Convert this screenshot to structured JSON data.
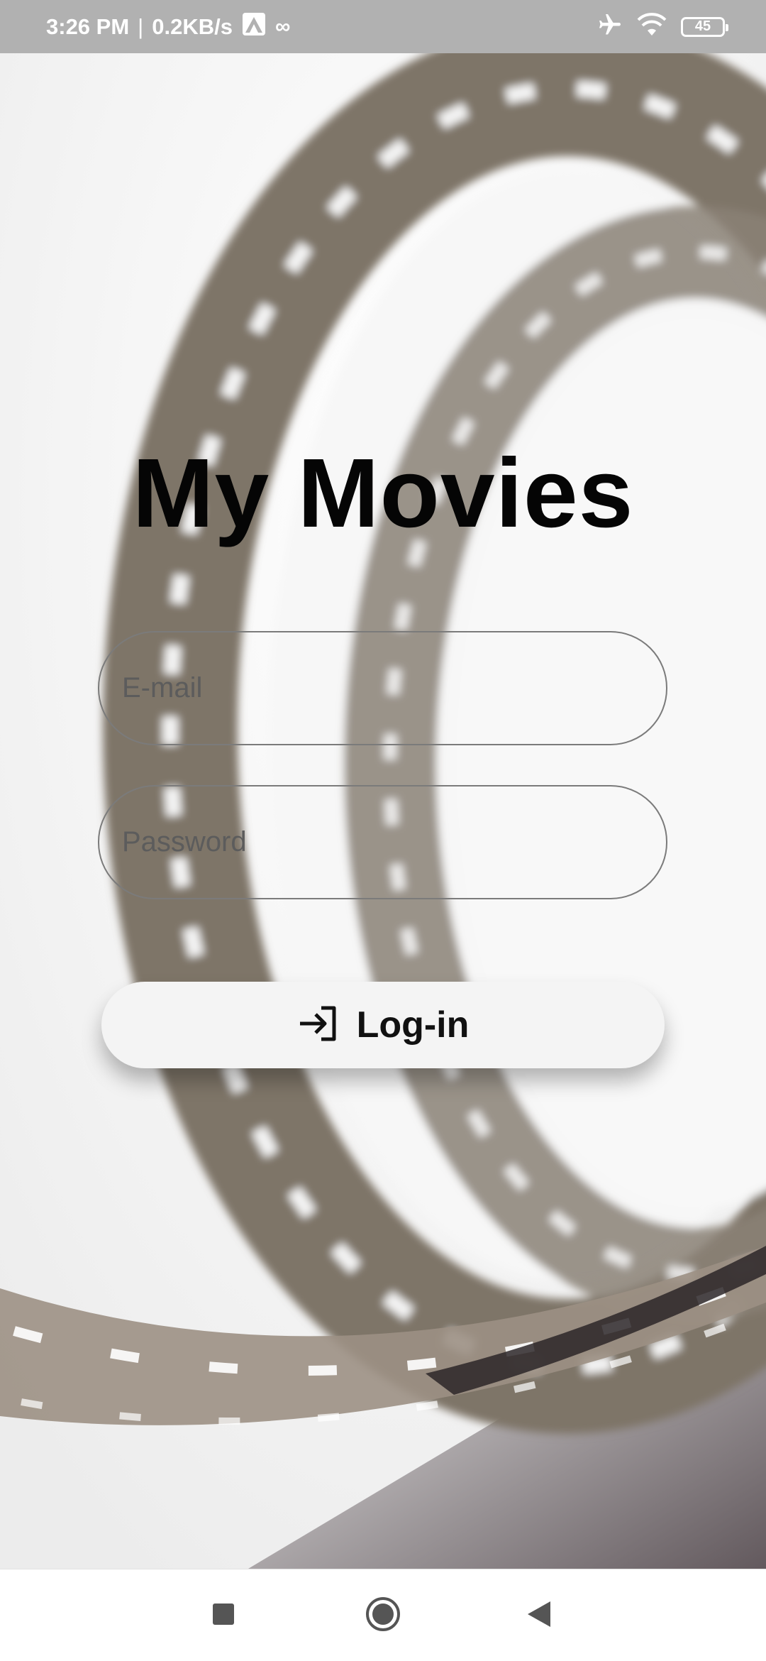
{
  "status_bar": {
    "time": "3:26 PM",
    "separator": "|",
    "net_speed": "0.2KB/s",
    "extra_icon": "∞",
    "battery_level": "45"
  },
  "app": {
    "title": "My Movies"
  },
  "form": {
    "email_placeholder": "E-mail",
    "password_placeholder": "Password",
    "login_label": "Log-in",
    "login_icon": "login-icon"
  },
  "nav_bar": {
    "recents_icon": "square-icon",
    "home_icon": "circle-icon",
    "back_icon": "triangle-back-icon"
  },
  "colors": {
    "status_bar_bg": "#b1b1b1",
    "background": "#f4f4f4",
    "film_strip": "#7e7468",
    "title_text": "#050505"
  }
}
